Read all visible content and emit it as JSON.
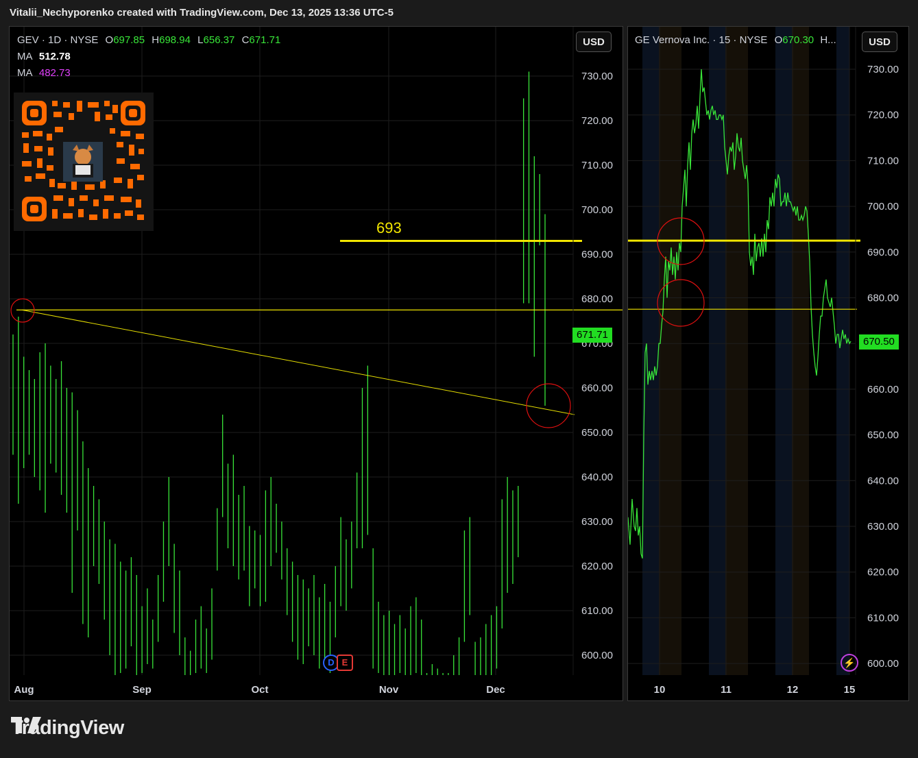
{
  "attribution": "Vitalii_Nechyporenko created with TradingView.com, Dec 13, 2025 13:36 UTC-5",
  "brand": "TradingView",
  "colors": {
    "bar": "#39e639",
    "level": "#f2e600",
    "trendline": "#e8e000",
    "circle": "#e01010",
    "ma2": "#e040fb",
    "tag": "#22dd22"
  },
  "left": {
    "legend": {
      "symbol": "GEV · 1D · NYSE",
      "o_label": "O",
      "o": "697.85",
      "h_label": "H",
      "h": "698.94",
      "l_label": "L",
      "l": "656.37",
      "c_label": "C",
      "c": "671.71"
    },
    "ma1": {
      "label": "MA",
      "value": "512.78"
    },
    "ma2": {
      "label": "MA",
      "value": "482.73"
    },
    "currency": "USD",
    "last_price": "671.71",
    "level_label": "693",
    "event_badges": [
      "D",
      "E"
    ]
  },
  "right": {
    "legend": {
      "symbol": "GE Vernova Inc. · 15 · NYSE",
      "o_label": "O",
      "o": "670.30",
      "rest": "H..."
    },
    "currency": "USD",
    "last_price": "670.50",
    "icon": "lightning-icon"
  },
  "chart_data": [
    {
      "type": "bar",
      "title": "GEV · 1D · NYSE",
      "ylim": [
        595,
        735
      ],
      "y_ticks": [
        "730.00",
        "720.00",
        "710.00",
        "700.00",
        "690.00",
        "680.00",
        "670.00",
        "660.00",
        "650.00",
        "640.00",
        "630.00",
        "620.00",
        "610.00",
        "600.00"
      ],
      "x_ticks": [
        "Aug",
        "Sep",
        "Oct",
        "Nov",
        "Dec"
      ],
      "grid": true,
      "levels": [
        693,
        677.5
      ],
      "trendline": {
        "from": 677.5,
        "to": 654
      },
      "bars": [
        [
          672,
          645
        ],
        [
          676,
          634
        ],
        [
          667,
          642
        ],
        [
          664,
          645
        ],
        [
          662,
          640
        ],
        [
          668,
          637
        ],
        [
          670,
          632
        ],
        [
          665,
          643
        ],
        [
          662,
          641
        ],
        [
          666,
          636
        ],
        [
          660,
          632
        ],
        [
          659,
          614
        ],
        [
          655,
          628
        ],
        [
          648,
          607
        ],
        [
          642,
          604
        ],
        [
          638,
          620
        ],
        [
          635,
          616
        ],
        [
          630,
          608
        ],
        [
          626,
          600
        ],
        [
          625,
          595
        ],
        [
          621,
          596
        ],
        [
          619,
          597
        ],
        [
          622,
          602
        ],
        [
          618,
          595
        ],
        [
          611,
          596
        ],
        [
          615,
          598
        ],
        [
          608,
          597
        ],
        [
          618,
          603
        ],
        [
          630,
          612
        ],
        [
          640,
          620
        ],
        [
          625,
          605
        ],
        [
          619,
          600
        ],
        [
          604,
          595
        ],
        [
          601,
          595
        ],
        [
          608,
          596
        ],
        [
          611,
          597
        ],
        [
          606,
          596
        ],
        [
          615,
          599
        ],
        [
          633,
          619
        ],
        [
          654,
          631
        ],
        [
          643,
          624
        ],
        [
          645,
          620
        ],
        [
          636,
          617
        ],
        [
          638,
          619
        ],
        [
          629,
          611
        ],
        [
          628,
          615
        ],
        [
          627,
          611
        ],
        [
          637,
          612
        ],
        [
          640,
          620
        ],
        [
          634,
          623
        ],
        [
          630,
          617
        ],
        [
          624,
          609
        ],
        [
          621,
          603
        ],
        [
          618,
          599
        ],
        [
          617,
          598
        ],
        [
          615,
          602
        ],
        [
          618,
          600
        ],
        [
          613,
          597
        ],
        [
          616,
          598
        ],
        [
          612,
          596
        ],
        [
          620,
          604
        ],
        [
          631,
          611
        ],
        [
          626,
          610
        ],
        [
          630,
          615
        ],
        [
          641,
          624
        ],
        [
          660,
          624
        ],
        [
          665,
          627
        ],
        [
          624,
          597
        ],
        [
          612,
          596
        ],
        [
          609,
          595
        ],
        [
          610,
          595
        ],
        [
          607,
          595
        ],
        [
          609,
          596
        ],
        [
          606,
          595
        ],
        [
          611,
          595
        ],
        [
          613,
          596
        ],
        [
          608,
          595
        ],
        [
          596,
          595
        ],
        [
          598,
          595
        ],
        [
          597,
          595
        ],
        [
          596,
          595
        ],
        [
          596,
          595
        ],
        [
          600,
          595
        ],
        [
          604,
          595
        ],
        [
          628,
          603
        ],
        [
          631,
          609
        ],
        [
          603,
          595
        ],
        [
          604,
          595
        ],
        [
          607,
          595
        ],
        [
          609,
          595
        ],
        [
          611,
          597
        ],
        [
          635,
          606
        ],
        [
          640,
          614
        ],
        [
          637,
          616
        ],
        [
          638,
          622
        ],
        [
          725,
          679
        ],
        [
          731,
          679
        ],
        [
          712,
          667
        ],
        [
          708,
          692
        ],
        [
          699,
          656
        ]
      ]
    },
    {
      "type": "bar",
      "title": "GE Vernova Inc. · 15 · NYSE",
      "ylim": [
        597,
        732
      ],
      "y_ticks": [
        "730.00",
        "720.00",
        "710.00",
        "700.00",
        "690.00",
        "680.00",
        "670.00",
        "660.00",
        "650.00",
        "640.00",
        "630.00",
        "620.00",
        "610.00",
        "600.00"
      ],
      "x_ticks": [
        "10",
        "11",
        "12",
        "15"
      ],
      "grid": true,
      "levels": [
        692.5,
        677.5
      ],
      "path": [
        [
          0,
          632
        ],
        [
          3,
          626
        ],
        [
          6,
          636
        ],
        [
          9,
          630
        ],
        [
          11,
          629
        ],
        [
          13,
          634
        ],
        [
          15,
          628
        ],
        [
          17,
          630
        ],
        [
          19,
          624
        ],
        [
          21,
          623
        ],
        [
          23,
          650
        ],
        [
          25,
          668
        ],
        [
          27,
          670
        ],
        [
          29,
          661
        ],
        [
          31,
          664
        ],
        [
          33,
          662
        ],
        [
          35,
          664
        ],
        [
          37,
          662
        ],
        [
          39,
          665
        ],
        [
          41,
          663
        ],
        [
          43,
          665
        ],
        [
          45,
          670
        ],
        [
          47,
          670
        ],
        [
          49,
          674
        ],
        [
          51,
          677
        ],
        [
          53,
          684
        ],
        [
          55,
          689
        ],
        [
          57,
          680
        ],
        [
          59,
          688
        ],
        [
          61,
          686
        ],
        [
          63,
          691
        ],
        [
          65,
          685
        ],
        [
          67,
          689
        ],
        [
          69,
          684
        ],
        [
          71,
          690
        ],
        [
          73,
          686
        ],
        [
          75,
          692
        ],
        [
          77,
          690
        ],
        [
          79,
          700
        ],
        [
          81,
          704
        ],
        [
          83,
          708
        ],
        [
          85,
          700
        ],
        [
          87,
          709
        ],
        [
          89,
          714
        ],
        [
          91,
          708
        ],
        [
          93,
          716
        ],
        [
          95,
          719
        ],
        [
          97,
          716
        ],
        [
          99,
          718
        ],
        [
          101,
          722
        ],
        [
          103,
          717
        ],
        [
          105,
          724
        ],
        [
          107,
          730
        ],
        [
          109,
          725
        ],
        [
          111,
          726
        ],
        [
          113,
          723
        ],
        [
          115,
          720
        ],
        [
          117,
          721
        ],
        [
          119,
          719
        ],
        [
          121,
          721
        ],
        [
          123,
          722
        ],
        [
          125,
          720
        ],
        [
          127,
          721
        ],
        [
          129,
          719
        ],
        [
          131,
          719
        ],
        [
          133,
          720
        ],
        [
          135,
          720
        ],
        [
          137,
          719
        ],
        [
          139,
          720
        ],
        [
          141,
          713
        ],
        [
          143,
          710
        ],
        [
          145,
          707
        ],
        [
          147,
          711
        ],
        [
          149,
          713
        ],
        [
          151,
          712
        ],
        [
          153,
          714
        ],
        [
          155,
          708
        ],
        [
          157,
          711
        ],
        [
          159,
          716
        ],
        [
          161,
          713
        ],
        [
          163,
          712
        ],
        [
          165,
          715
        ],
        [
          167,
          710
        ],
        [
          169,
          708
        ],
        [
          171,
          706
        ],
        [
          173,
          709
        ],
        [
          175,
          705
        ],
        [
          177,
          690
        ],
        [
          179,
          687
        ],
        [
          181,
          689
        ],
        [
          183,
          685
        ],
        [
          185,
          694
        ],
        [
          187,
          688
        ],
        [
          189,
          691
        ],
        [
          191,
          692
        ],
        [
          193,
          689
        ],
        [
          195,
          693
        ],
        [
          197,
          689
        ],
        [
          199,
          694
        ],
        [
          201,
          690
        ],
        [
          203,
          697
        ],
        [
          205,
          695
        ],
        [
          207,
          702
        ],
        [
          209,
          700
        ],
        [
          211,
          703
        ],
        [
          213,
          700
        ],
        [
          215,
          706
        ],
        [
          217,
          704
        ],
        [
          219,
          707
        ],
        [
          221,
          706
        ],
        [
          223,
          700
        ],
        [
          225,
          701
        ],
        [
          227,
          701
        ],
        [
          229,
          703
        ],
        [
          231,
          700
        ],
        [
          233,
          703
        ],
        [
          235,
          701
        ],
        [
          237,
          701
        ],
        [
          239,
          700
        ],
        [
          241,
          699
        ],
        [
          243,
          700
        ],
        [
          245,
          698
        ],
        [
          247,
          700
        ],
        [
          249,
          697
        ],
        [
          251,
          697
        ],
        [
          253,
          698
        ],
        [
          255,
          697
        ],
        [
          257,
          698
        ],
        [
          259,
          700
        ],
        [
          261,
          699
        ],
        [
          263,
          694
        ],
        [
          265,
          688
        ],
        [
          267,
          678
        ],
        [
          269,
          672
        ],
        [
          271,
          668
        ],
        [
          273,
          665
        ],
        [
          275,
          663
        ],
        [
          277,
          667
        ],
        [
          279,
          672
        ],
        [
          281,
          676
        ],
        [
          283,
          676
        ],
        [
          285,
          680
        ],
        [
          287,
          682
        ],
        [
          289,
          684
        ],
        [
          291,
          680
        ],
        [
          293,
          679
        ],
        [
          295,
          678
        ],
        [
          297,
          680
        ],
        [
          299,
          677
        ],
        [
          301,
          674
        ],
        [
          303,
          670
        ],
        [
          305,
          672
        ],
        [
          307,
          672
        ],
        [
          309,
          669
        ],
        [
          311,
          671
        ],
        [
          313,
          673
        ],
        [
          315,
          671
        ],
        [
          317,
          672
        ],
        [
          319,
          670
        ],
        [
          321,
          671
        ],
        [
          323,
          670
        ],
        [
          325,
          670.5
        ]
      ]
    }
  ]
}
